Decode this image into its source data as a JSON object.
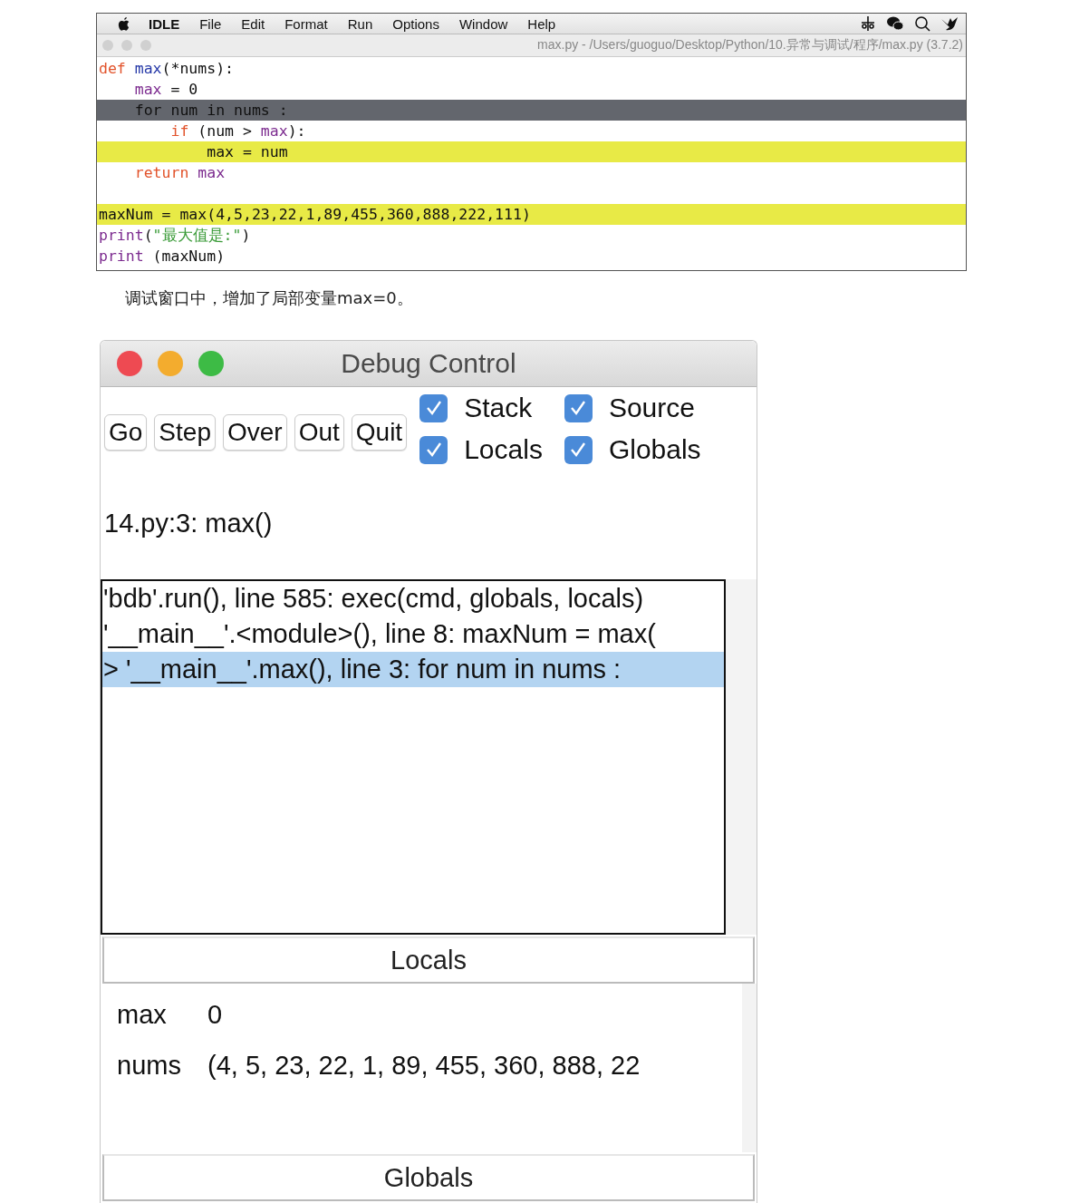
{
  "menubar": {
    "app": "IDLE",
    "menus": [
      "File",
      "Edit",
      "Format",
      "Run",
      "Options",
      "Window",
      "Help"
    ]
  },
  "editor": {
    "title": "max.py - /Users/guoguo/Desktop/Python/10.异常与调试/程序/max.py (3.7.2)",
    "lines": [
      {
        "current": false,
        "breakpoint": false,
        "tokens": [
          {
            "kind": "keyword",
            "text": "def"
          },
          {
            "kind": "defname",
            "text": " max"
          },
          {
            "kind": "plain",
            "text": "(*nums):"
          }
        ]
      },
      {
        "current": false,
        "breakpoint": false,
        "tokens": [
          {
            "kind": "builtin",
            "text": "    max"
          },
          {
            "kind": "plain",
            "text": " = 0"
          }
        ]
      },
      {
        "current": true,
        "breakpoint": false,
        "tokens": [
          {
            "kind": "plain",
            "text": "    for num in nums :"
          }
        ]
      },
      {
        "current": false,
        "breakpoint": false,
        "tokens": [
          {
            "kind": "keyword",
            "text": "        if"
          },
          {
            "kind": "plain",
            "text": " (num > "
          },
          {
            "kind": "builtin",
            "text": "max"
          },
          {
            "kind": "plain",
            "text": "):"
          }
        ]
      },
      {
        "current": false,
        "breakpoint": true,
        "tokens": [
          {
            "kind": "plain",
            "text": "            max = num"
          }
        ]
      },
      {
        "current": false,
        "breakpoint": false,
        "tokens": [
          {
            "kind": "keyword",
            "text": "    return"
          },
          {
            "kind": "builtin",
            "text": " max"
          }
        ]
      },
      {
        "current": false,
        "breakpoint": true,
        "blank_before": true,
        "tokens": [
          {
            "kind": "plain",
            "text": "maxNum = max(4,5,23,22,1,89,455,360,888,222,111)"
          }
        ]
      },
      {
        "current": false,
        "breakpoint": false,
        "tokens": [
          {
            "kind": "builtin",
            "text": "print"
          },
          {
            "kind": "plain",
            "text": "("
          },
          {
            "kind": "string",
            "text": "\"最大值是:\""
          },
          {
            "kind": "plain",
            "text": ")"
          }
        ]
      },
      {
        "current": false,
        "breakpoint": false,
        "tokens": [
          {
            "kind": "builtin",
            "text": "print"
          },
          {
            "kind": "plain",
            "text": " (maxNum)"
          }
        ]
      }
    ]
  },
  "caption": "调试窗口中，增加了局部变量max=0。",
  "debug": {
    "title": "Debug Control",
    "buttons": [
      "Go",
      "Step",
      "Over",
      "Out",
      "Quit"
    ],
    "options": [
      {
        "label": "Stack",
        "checked": true
      },
      {
        "label": "Source",
        "checked": true
      },
      {
        "label": "Locals",
        "checked": true
      },
      {
        "label": "Globals",
        "checked": true
      }
    ],
    "status": "14.py:3: max()",
    "stack": [
      {
        "text": "'bdb'.run(), line 585: exec(cmd, globals, locals)",
        "selected": false
      },
      {
        "text": "'__main__'.<module>(), line 8: maxNum = max(",
        "selected": false
      },
      {
        "text": "> '__main__'.max(), line 3: for num in nums :",
        "selected": true
      }
    ],
    "locals_header": "Locals",
    "locals": [
      {
        "name": "max",
        "value": "0"
      },
      {
        "name": "nums",
        "value": "(4, 5, 23, 22, 1, 89, 455, 360, 888, 22"
      }
    ],
    "globals_header": "Globals"
  }
}
